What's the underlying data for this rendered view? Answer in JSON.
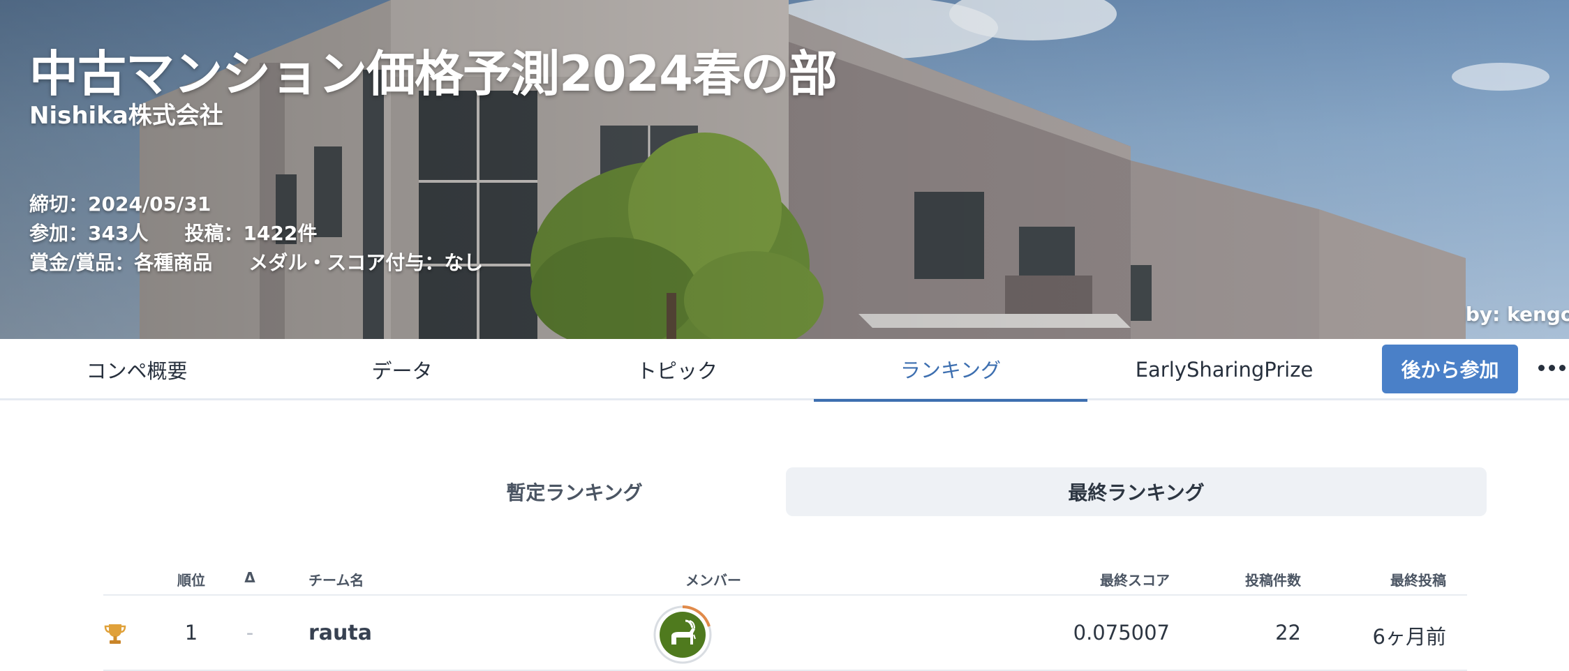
{
  "hero": {
    "title": "中古マンション価格予測2024春の部",
    "organizer": "Nishika株式会社",
    "deadline": "締切：2024/05/31",
    "participants": "参加：343人",
    "submissions": "投稿：1422件",
    "prize": "賞金/賞品：各種商品",
    "medal": "メダル・スコア付与：なし",
    "credit": "by: kengo.f"
  },
  "tabs": [
    {
      "label": "コンペ概要",
      "active": false
    },
    {
      "label": "データ",
      "active": false
    },
    {
      "label": "トピック",
      "active": false
    },
    {
      "label": "ランキング",
      "active": true
    },
    {
      "label": "EarlySharingPrize",
      "active": false
    }
  ],
  "actions": {
    "join_label": "後から参加",
    "more_icon": "more-horizontal-icon"
  },
  "ranking_switch": {
    "provisional": "暫定ランキング",
    "final": "最終ランキング",
    "selected": "final"
  },
  "table": {
    "headers": {
      "rank": "順位",
      "delta": "Δ",
      "team": "チーム名",
      "members": "メンバー",
      "score": "最終スコア",
      "count": "投稿件数",
      "last": "最終投稿"
    },
    "rows": [
      {
        "rank": "1",
        "delta": "-",
        "team": "rauta",
        "score": "0.075007",
        "count": "22",
        "last": "6ヶ月前",
        "icon": "trophy-icon",
        "avatar_icon": "goat-avatar-icon"
      }
    ]
  },
  "colors": {
    "accent": "#3d6fb0",
    "button": "#4a80c8",
    "trophy": "#e0a13a",
    "avatar_bg": "#4f7a1e",
    "avatar_ring": "#e08a4a"
  }
}
